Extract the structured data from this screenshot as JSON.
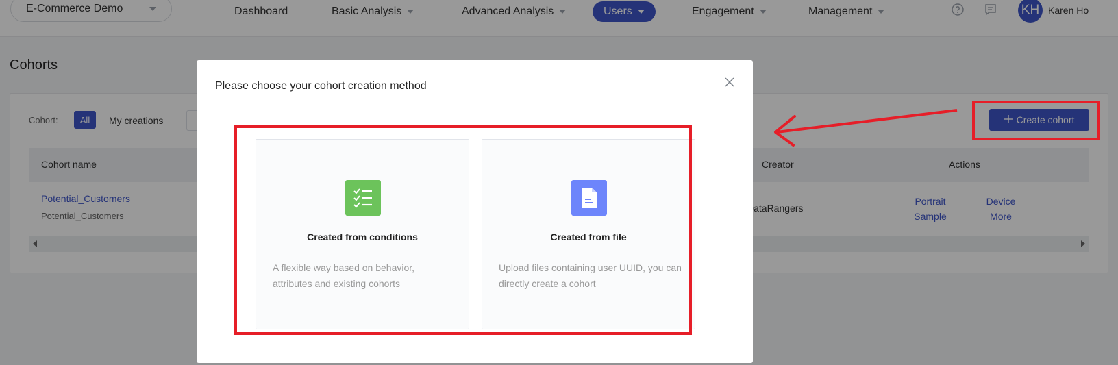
{
  "topnav": {
    "project": "E-Commerce Demo",
    "items": [
      {
        "label": "Dashboard",
        "has_caret": false
      },
      {
        "label": "Basic Analysis",
        "has_caret": true
      },
      {
        "label": "Advanced Analysis",
        "has_caret": true
      },
      {
        "label": "Users",
        "has_caret": true,
        "active": true
      },
      {
        "label": "Engagement",
        "has_caret": true
      },
      {
        "label": "Management",
        "has_caret": true
      }
    ],
    "help_icon": "question-circle-icon",
    "message_icon": "message-icon",
    "avatar_initials": "KH",
    "user_name": "Karen Ho"
  },
  "page": {
    "title": "Cohorts",
    "filter": {
      "label": "Cohort:",
      "all": "All",
      "mine": "My creations"
    },
    "create_button": "Create cohort",
    "table": {
      "headers": [
        "Cohort name",
        "Creator",
        "Actions"
      ],
      "rows": [
        {
          "name": "Potential_Customers",
          "description": "Potential_Customers",
          "creator": "DataRangers",
          "actions": [
            "Portrait",
            "Sample",
            "Device",
            "More"
          ]
        }
      ]
    }
  },
  "modal": {
    "title": "Please choose your cohort creation method",
    "close_icon": "close-icon",
    "options": [
      {
        "icon": "checklist-icon",
        "icon_color": "#6cc35b",
        "title": "Created from conditions",
        "description": "A flexible way based on behavior, attributes and existing cohorts"
      },
      {
        "icon": "document-icon",
        "icon_color": "#6d85fb",
        "title": "Created from file",
        "description": "Upload files containing user UUID, you can directly create a cohort"
      }
    ]
  },
  "colors": {
    "accent": "#3f56c8",
    "annotation": "#e61e28"
  }
}
